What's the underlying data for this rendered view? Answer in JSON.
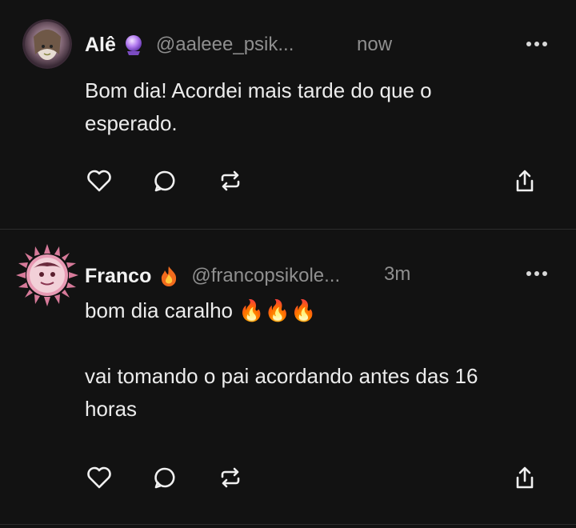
{
  "colors": {
    "background": "#121212",
    "text": "#ececec",
    "muted": "#8f8f8f",
    "divider": "#2c2c2c"
  },
  "posts": [
    {
      "name": "Alê",
      "badge_icon": "crystal-ball-icon",
      "handle": "@aaleee_psik...",
      "time": "now",
      "text_lines": [
        "Bom dia! Acordei mais tarde do que o",
        "esperado."
      ]
    },
    {
      "name": "Franco",
      "badge_icon": "fire-icon",
      "handle": "@francopsikole...",
      "time": "3m",
      "text_line1": "bom dia caralho",
      "text_line1_emoji": "🔥🔥🔥",
      "text_line2": "vai tomando o pai acordando antes das 16",
      "text_line3": "horas"
    }
  ]
}
